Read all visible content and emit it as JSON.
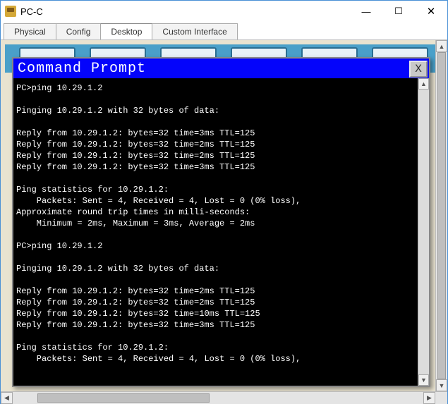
{
  "window": {
    "title": "PC-C"
  },
  "controls": {
    "minimize": "—",
    "maximize": "☐",
    "close": "✕"
  },
  "tabs": [
    {
      "label": "Physical",
      "active": false
    },
    {
      "label": "Config",
      "active": false
    },
    {
      "label": "Desktop",
      "active": true
    },
    {
      "label": "Custom Interface",
      "active": false
    }
  ],
  "cmd": {
    "title": "Command Prompt",
    "close": "X",
    "lines": [
      "PC>ping 10.29.1.2",
      "",
      "Pinging 10.29.1.2 with 32 bytes of data:",
      "",
      "Reply from 10.29.1.2: bytes=32 time=3ms TTL=125",
      "Reply from 10.29.1.2: bytes=32 time=2ms TTL=125",
      "Reply from 10.29.1.2: bytes=32 time=2ms TTL=125",
      "Reply from 10.29.1.2: bytes=32 time=3ms TTL=125",
      "",
      "Ping statistics for 10.29.1.2:",
      "    Packets: Sent = 4, Received = 4, Lost = 0 (0% loss),",
      "Approximate round trip times in milli-seconds:",
      "    Minimum = 2ms, Maximum = 3ms, Average = 2ms",
      "",
      "PC>ping 10.29.1.2",
      "",
      "Pinging 10.29.1.2 with 32 bytes of data:",
      "",
      "Reply from 10.29.1.2: bytes=32 time=2ms TTL=125",
      "Reply from 10.29.1.2: bytes=32 time=2ms TTL=125",
      "Reply from 10.29.1.2: bytes=32 time=10ms TTL=125",
      "Reply from 10.29.1.2: bytes=32 time=3ms TTL=125",
      "",
      "Ping statistics for 10.29.1.2:",
      "    Packets: Sent = 4, Received = 4, Lost = 0 (0% loss),"
    ]
  },
  "scroll_glyphs": {
    "up": "▲",
    "down": "▼",
    "left": "◀",
    "right": "▶"
  }
}
